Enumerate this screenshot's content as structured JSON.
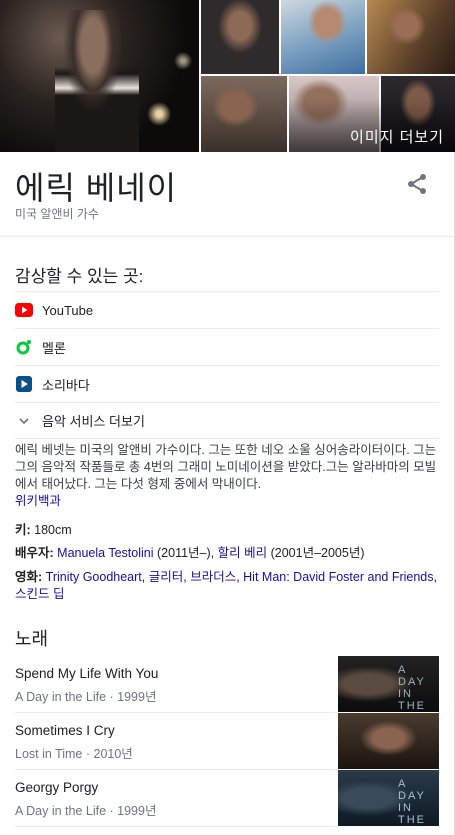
{
  "images": {
    "more_label": "이미지 더보기"
  },
  "header": {
    "title": "에릭 베네이",
    "subtitle": "미국 알앤비 가수",
    "share_icon": "share-icon"
  },
  "listen": {
    "heading": "감상할 수 있는 곳:",
    "services": [
      {
        "label": "YouTube",
        "icon": "youtube-icon",
        "color": "#ff0000"
      },
      {
        "label": "멜론",
        "icon": "melon-icon",
        "color": "#00cd3c"
      },
      {
        "label": "소리바다",
        "icon": "soribada-icon",
        "color": "#1a73e8"
      }
    ],
    "more_label": "음악 서비스 더보기"
  },
  "description": {
    "text": "에릭 베넷는 미국의 알앤비 가수이다. 그는 또한 네오 소울 싱어송라이터이다. 그는 그의 음악적 작품들로 총 4번의 그래미 노미네이션을 받았다.그는 알라바마의 모빌에서 태어났다. 그는 다섯 형제 중에서 막내이다.",
    "source": "위키백과"
  },
  "facts": {
    "height_label": "키:",
    "height_value": "180cm",
    "spouse_label": "배우자:",
    "spouse1": "Manuela Testolini",
    "spouse1_years": "(2011년–),",
    "spouse2": "할리 베리",
    "spouse2_years": "(2001년–2005년)",
    "films_label": "영화:",
    "film1": "Trinity Goodheart",
    "film2": "글리터",
    "film3": "브라더스",
    "film4": "Hit Man: David Foster and Friends",
    "film5": "스킨드 딥"
  },
  "songs": {
    "heading": "노래",
    "items": [
      {
        "title": "Spend My Life With You",
        "album": "A Day in the Life",
        "year": "1999년"
      },
      {
        "title": "Sometimes I Cry",
        "album": "Lost in Time",
        "year": "2010년"
      },
      {
        "title": "Georgy Porgy",
        "album": "A Day in the Life",
        "year": "1999년"
      }
    ]
  }
}
